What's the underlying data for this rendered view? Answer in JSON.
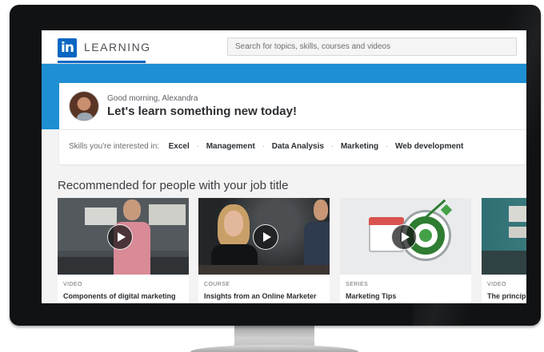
{
  "header": {
    "logo_mark": "in",
    "logo_text": "LEARNING",
    "search_placeholder": "Search for topics, skills, courses and videos"
  },
  "greeting": {
    "salutation": "Good morning, Alexandra",
    "headline": "Let's learn something new today!"
  },
  "skills": {
    "label": "Skills you're interested in:",
    "items": [
      "Excel",
      "Management",
      "Data Analysis",
      "Marketing",
      "Web development"
    ]
  },
  "recommended": {
    "title": "Recommended for people with your job title",
    "courses": [
      {
        "type": "VIDEO",
        "title": "Components of digital marketing"
      },
      {
        "type": "COURSE",
        "title": "Insights from an Online Marketer"
      },
      {
        "type": "SERIES",
        "title": "Marketing Tips"
      },
      {
        "type": "VIDEO",
        "title": "The principl"
      }
    ]
  },
  "colors": {
    "brand_blue": "#0a66c2",
    "banner_blue": "#1e8fd3"
  }
}
